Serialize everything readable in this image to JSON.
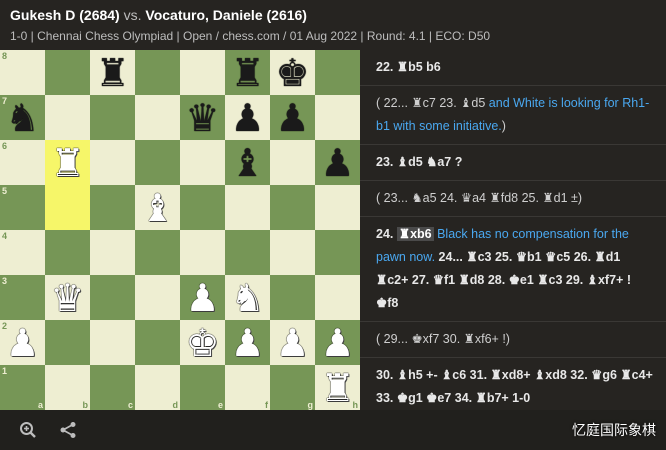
{
  "header": {
    "white_player": "Gukesh D (2684)",
    "vs": "vs.",
    "black_player": "Vocaturo, Daniele (2616)",
    "subtitle": "1-0 | Chennai Chess Olympiad | Open / chess.com / 01 Aug 2022 | Round: 4.1 | ECO: D50"
  },
  "board": {
    "files": [
      "a",
      "b",
      "c",
      "d",
      "e",
      "f",
      "g",
      "h"
    ],
    "ranks": [
      "8",
      "7",
      "6",
      "5",
      "4",
      "3",
      "2",
      "1"
    ],
    "position": [
      [
        "",
        "",
        "bR",
        "",
        "",
        "bR",
        "bK",
        ""
      ],
      [
        "bN",
        "",
        "",
        "",
        "bQ",
        "bP",
        "bP",
        ""
      ],
      [
        "",
        "wR",
        "",
        "",
        "",
        "bB",
        "",
        "bP"
      ],
      [
        "",
        "",
        "",
        "wB",
        "",
        "",
        "",
        ""
      ],
      [
        "",
        "",
        "",
        "",
        "",
        "",
        "",
        ""
      ],
      [
        "",
        "wQ",
        "",
        "",
        "wP",
        "wN",
        "",
        ""
      ],
      [
        "wP",
        "",
        "",
        "",
        "wK",
        "wP",
        "wP",
        "wP"
      ],
      [
        "",
        "",
        "",
        "",
        "",
        "",
        "",
        "wR"
      ]
    ],
    "highlighted_squares": [
      "b6",
      "b5"
    ]
  },
  "moves": [
    {
      "type": "main",
      "segments": [
        {
          "t": "22. "
        },
        {
          "t": "♜"
        },
        {
          "t": "b5 b6"
        }
      ]
    },
    {
      "type": "var",
      "segments": [
        {
          "t": "( 22... "
        },
        {
          "t": "♜"
        },
        {
          "t": "c7 23. "
        },
        {
          "t": "♝"
        },
        {
          "t": "d5 "
        },
        {
          "t": "and White is looking for Rh1-b1 with some initiative.",
          "c": true
        },
        {
          "t": ")"
        }
      ]
    },
    {
      "type": "main",
      "segments": [
        {
          "t": "23. "
        },
        {
          "t": "♝"
        },
        {
          "t": "d5 "
        },
        {
          "t": "♞"
        },
        {
          "t": "a7 ?"
        }
      ]
    },
    {
      "type": "var",
      "segments": [
        {
          "t": "( 23... "
        },
        {
          "t": "♞"
        },
        {
          "t": "a5 24. "
        },
        {
          "t": "♛"
        },
        {
          "t": "a4 "
        },
        {
          "t": "♜"
        },
        {
          "t": "fd8 25. "
        },
        {
          "t": "♜"
        },
        {
          "t": "d1 ±)"
        }
      ]
    },
    {
      "type": "main",
      "segments": [
        {
          "t": "24. "
        },
        {
          "t": "♜xb6",
          "h": true
        },
        {
          "t": " "
        },
        {
          "t": "Black has no compensation for the pawn now.",
          "c": true
        },
        {
          "t": " 24... "
        },
        {
          "t": "♜"
        },
        {
          "t": "c3 25. "
        },
        {
          "t": "♛"
        },
        {
          "t": "b1 "
        },
        {
          "t": "♛"
        },
        {
          "t": "c5 26. "
        },
        {
          "t": "♜"
        },
        {
          "t": "d1 "
        },
        {
          "t": "♜"
        },
        {
          "t": "c2+ 27. "
        },
        {
          "t": "♛"
        },
        {
          "t": "f1 "
        },
        {
          "t": "♜"
        },
        {
          "t": "d8 28. "
        },
        {
          "t": "♚"
        },
        {
          "t": "e1 "
        },
        {
          "t": "♜"
        },
        {
          "t": "c3 29. "
        },
        {
          "t": "♝"
        },
        {
          "t": "xf7+ ! "
        },
        {
          "t": "♚"
        },
        {
          "t": "f8"
        }
      ]
    },
    {
      "type": "var",
      "segments": [
        {
          "t": "( 29... "
        },
        {
          "t": "♚"
        },
        {
          "t": "xf7 30. "
        },
        {
          "t": "♜"
        },
        {
          "t": "xf6+ !)"
        }
      ]
    },
    {
      "type": "main",
      "segments": [
        {
          "t": "30. "
        },
        {
          "t": "♝"
        },
        {
          "t": "h5 +- "
        },
        {
          "t": "♝"
        },
        {
          "t": "c6 31. "
        },
        {
          "t": "♜"
        },
        {
          "t": "xd8+ "
        },
        {
          "t": "♝"
        },
        {
          "t": "xd8 32. "
        },
        {
          "t": "♛"
        },
        {
          "t": "g6 "
        },
        {
          "t": "♜"
        },
        {
          "t": "c4+ 33. "
        },
        {
          "t": "♚"
        },
        {
          "t": "g1 "
        },
        {
          "t": "♚"
        },
        {
          "t": "e7 34. "
        },
        {
          "t": "♜"
        },
        {
          "t": "b7+ 1-0"
        }
      ]
    }
  ],
  "footer": {
    "zoom_icon": "zoom-icon",
    "share_icon": "share-icon",
    "watermark": "忆庭国际象棋"
  },
  "colors": {
    "light_square": "#eeeed2",
    "dark_square": "#769656",
    "highlight": "#f6f669",
    "comment": "#4aa8f0"
  }
}
